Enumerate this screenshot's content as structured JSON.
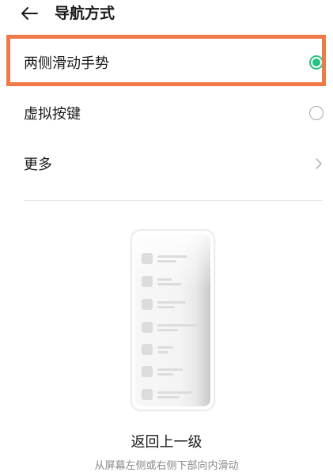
{
  "header": {
    "title": "导航方式",
    "back_icon": "arrow-left-icon"
  },
  "options": [
    {
      "label": "两侧滑动手势",
      "control": "radio",
      "selected": true
    },
    {
      "label": "虚拟按键",
      "control": "radio",
      "selected": false
    },
    {
      "label": "更多",
      "control": "chevron",
      "selected": false
    }
  ],
  "highlight_color": "#ef7a48",
  "accent_color": "#26c281",
  "illustration": {
    "caption_title": "返回上一级",
    "caption_sub": "从屏幕左侧或右侧下部向内滑动"
  }
}
